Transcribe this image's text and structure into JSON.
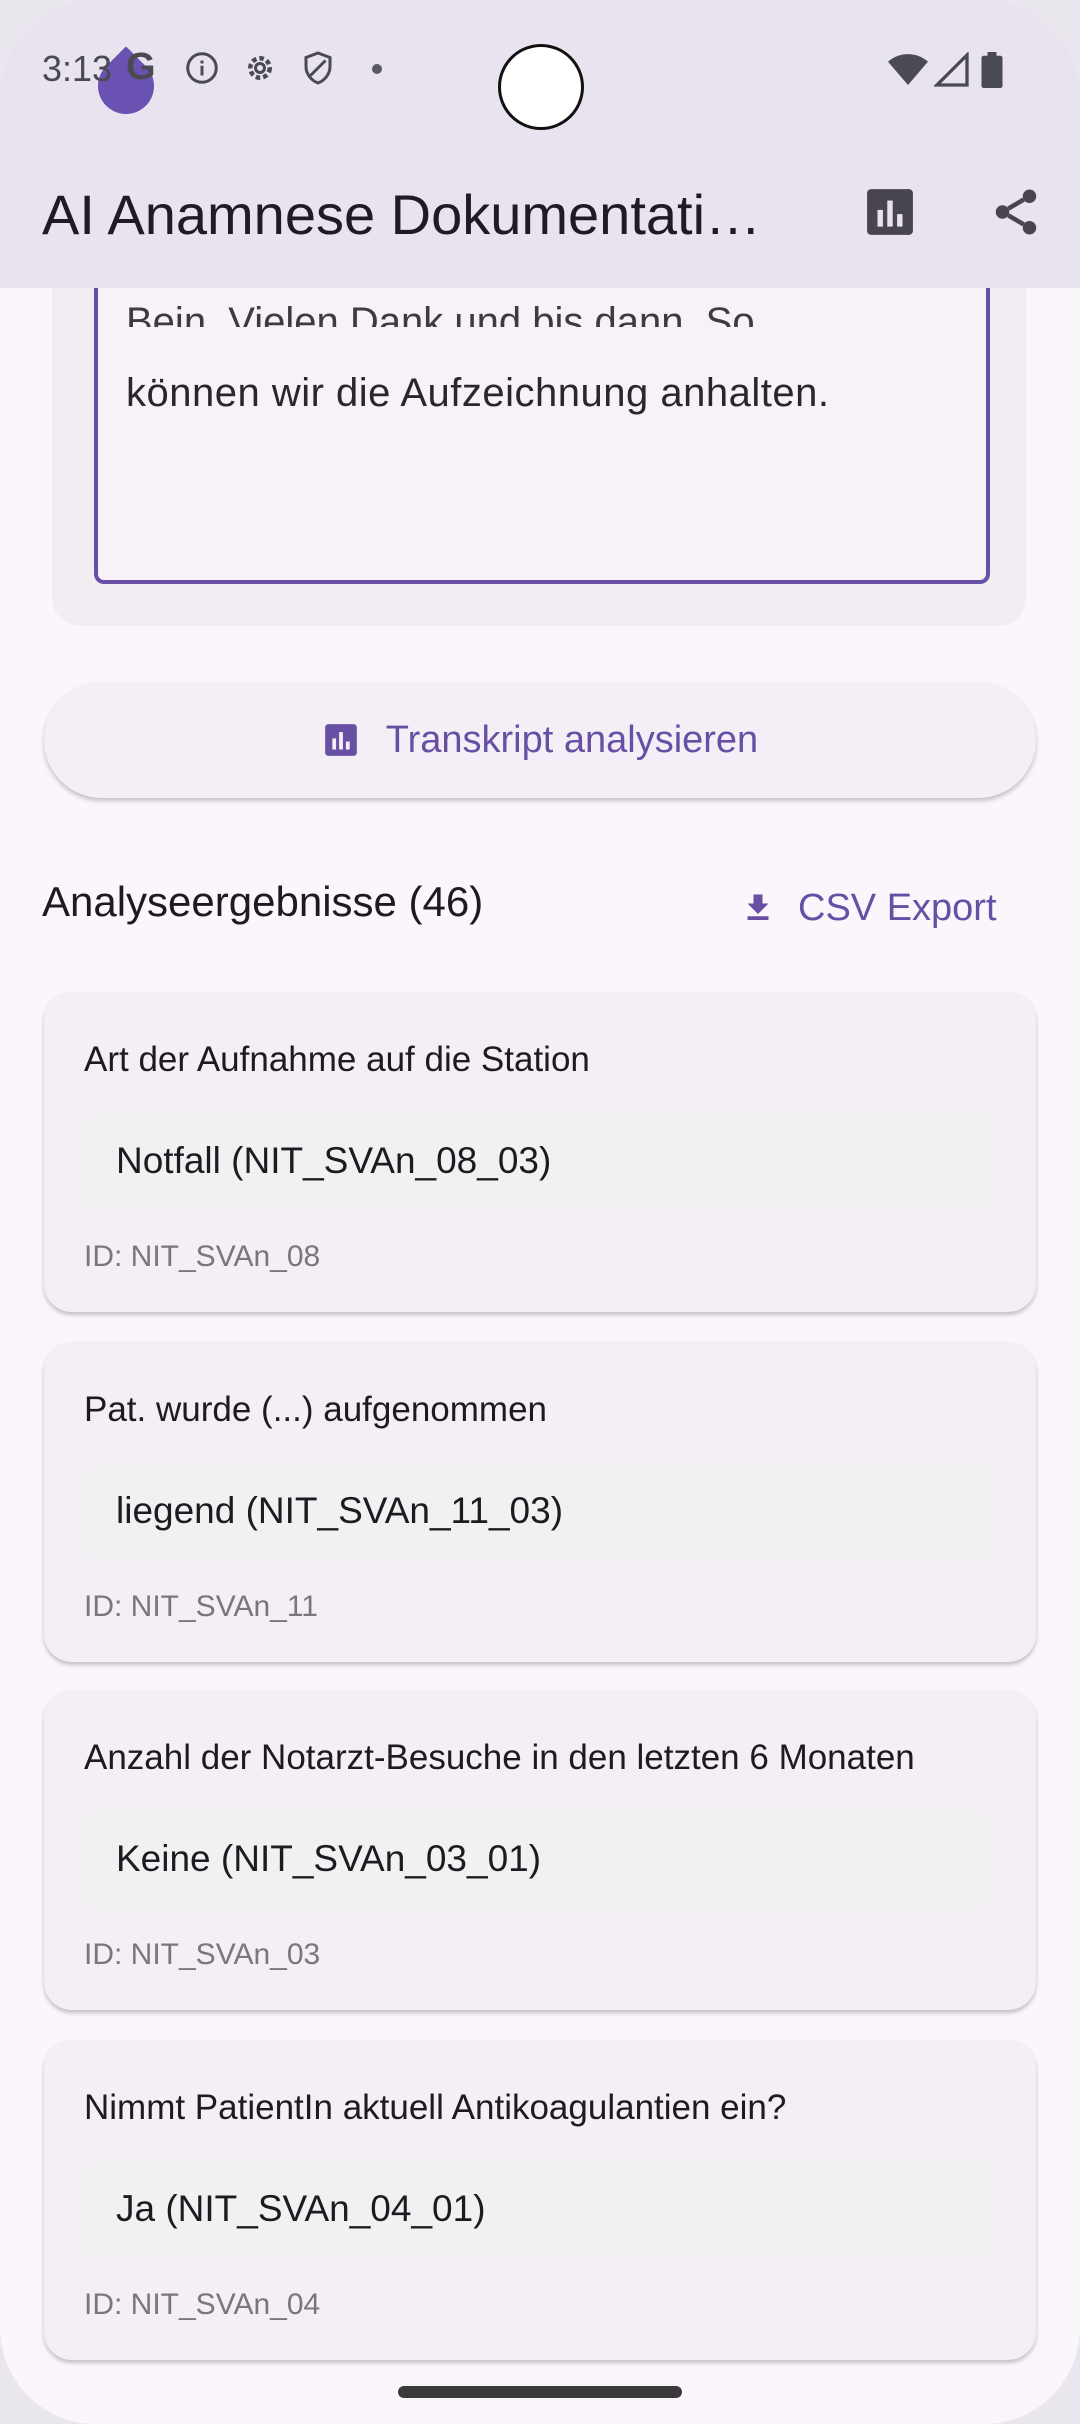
{
  "status_bar": {
    "time": "3:13",
    "g_label": "G"
  },
  "app_bar": {
    "title": "AI Anamnese Dokumentati…"
  },
  "transcript": {
    "partial_line": "Bein. Vielen Dank und bis dann. So,",
    "last_line": "können wir die Aufzeichnung anhalten."
  },
  "analyze_button": {
    "label": "Transkript analysieren"
  },
  "results_section": {
    "title": "Analyseergebnisse (46)",
    "csv_label": "CSV Export"
  },
  "results": [
    {
      "question": "Art der Aufnahme auf die Station",
      "answer": "Notfall (NIT_SVAn_08_03)",
      "id": "ID: NIT_SVAn_08"
    },
    {
      "question": "Pat. wurde (...) aufgenommen",
      "answer": "liegend (NIT_SVAn_11_03)",
      "id": "ID: NIT_SVAn_11"
    },
    {
      "question": "Anzahl der Notarzt-Besuche in den letzten 6 Monaten",
      "answer": "Keine (NIT_SVAn_03_01)",
      "id": "ID: NIT_SVAn_03"
    },
    {
      "question": "Nimmt PatientIn aktuell Antikoagulantien ein?",
      "answer": "Ja (NIT_SVAn_04_01)",
      "id": "ID: NIT_SVAn_04"
    }
  ],
  "colors": {
    "accent": "#6750a4",
    "app_bar_bg": "#e8e3ee",
    "page_bg": "#fbf5fc"
  },
  "icons": [
    "info-icon",
    "settings-icon",
    "shield-icon",
    "wifi-icon",
    "signal-icon",
    "battery-icon",
    "bar-chart-icon",
    "share-icon",
    "download-icon"
  ]
}
